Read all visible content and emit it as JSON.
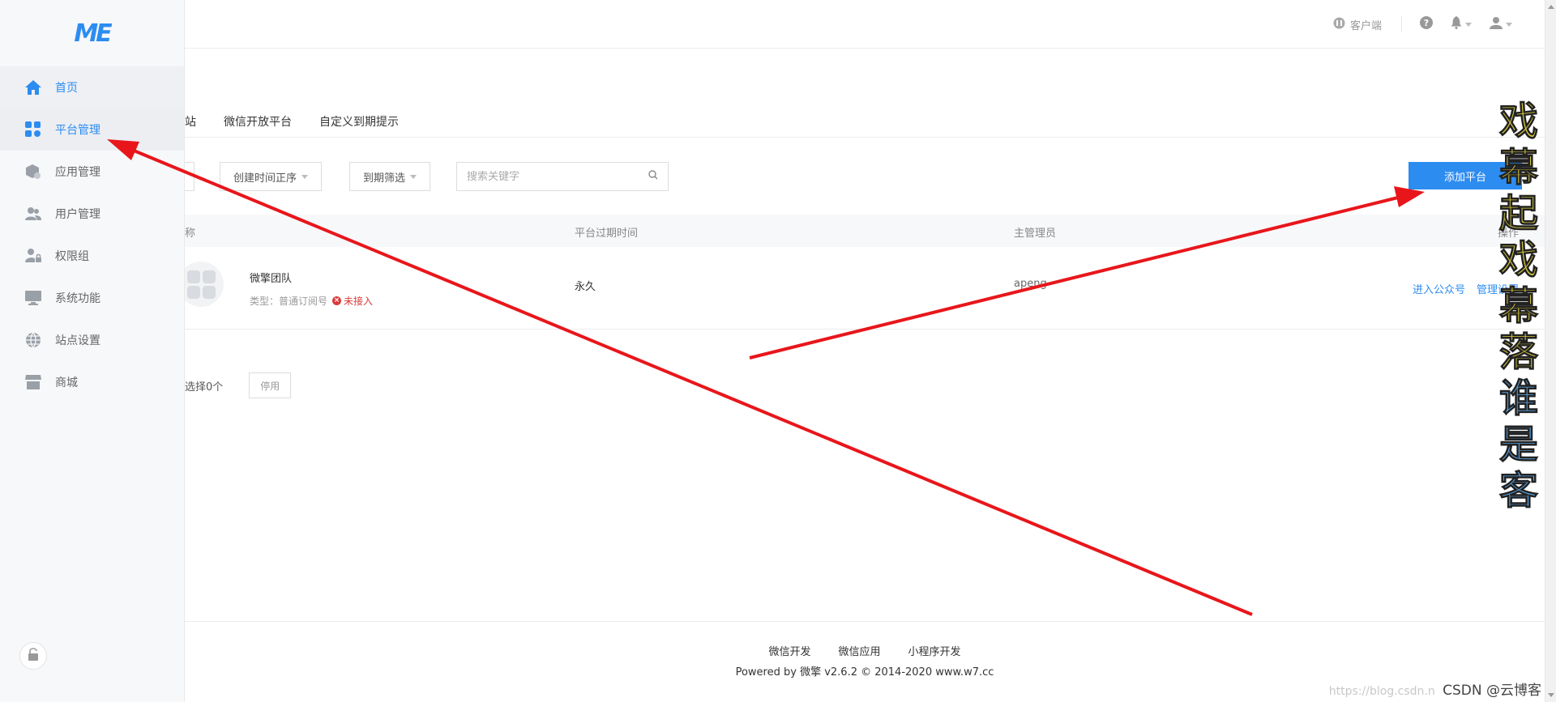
{
  "sidebar": {
    "logo": "ME",
    "items": [
      {
        "label": "首页",
        "icon": "home-icon"
      },
      {
        "label": "平台管理",
        "icon": "apps-grid-icon"
      },
      {
        "label": "应用管理",
        "icon": "cube-icon"
      },
      {
        "label": "用户管理",
        "icon": "users-icon"
      },
      {
        "label": "权限组",
        "icon": "user-lock-icon"
      },
      {
        "label": "系统功能",
        "icon": "monitor-icon"
      },
      {
        "label": "站点设置",
        "icon": "globe-icon"
      },
      {
        "label": "商城",
        "icon": "store-icon"
      }
    ],
    "active_index": 1
  },
  "header": {
    "client_label": "客户端"
  },
  "tabs": [
    {
      "label": "站"
    },
    {
      "label": "微信开放平台"
    },
    {
      "label": "自定义到期提示"
    }
  ],
  "filters": {
    "sort_label": "创建时间正序",
    "expire_label": "到期筛选",
    "search_placeholder": "搜索关键字",
    "add_button": "添加平台"
  },
  "table": {
    "headers": {
      "name": "称",
      "expire": "平台过期时间",
      "admin": "主管理员",
      "ops": "操作"
    },
    "rows": [
      {
        "name": "微擎团队",
        "type": "类型：普通订阅号",
        "status": "未接入",
        "expire": "永久",
        "admin": "apeng",
        "op1": "进入公众号",
        "op2": "管理设置"
      }
    ]
  },
  "batch": {
    "selected": "选择0个",
    "disable": "停用"
  },
  "footer": {
    "links": [
      "微信开发",
      "微信应用",
      "小程序开发"
    ],
    "powered": "Powered by 微擎 v2.6.2 © 2014-2020 www.w7.cc"
  },
  "watermark": {
    "faint": "https://blog.csdn.n",
    "main": "CSDN @云博客"
  },
  "overlay": {
    "lines": [
      "戏",
      "幕",
      "起",
      "戏",
      "幕",
      "落",
      "谁",
      "是",
      "客"
    ]
  },
  "colors": {
    "accent": "#2d8cf0",
    "arrow": "#e8161b",
    "error": "#d83b3b"
  }
}
